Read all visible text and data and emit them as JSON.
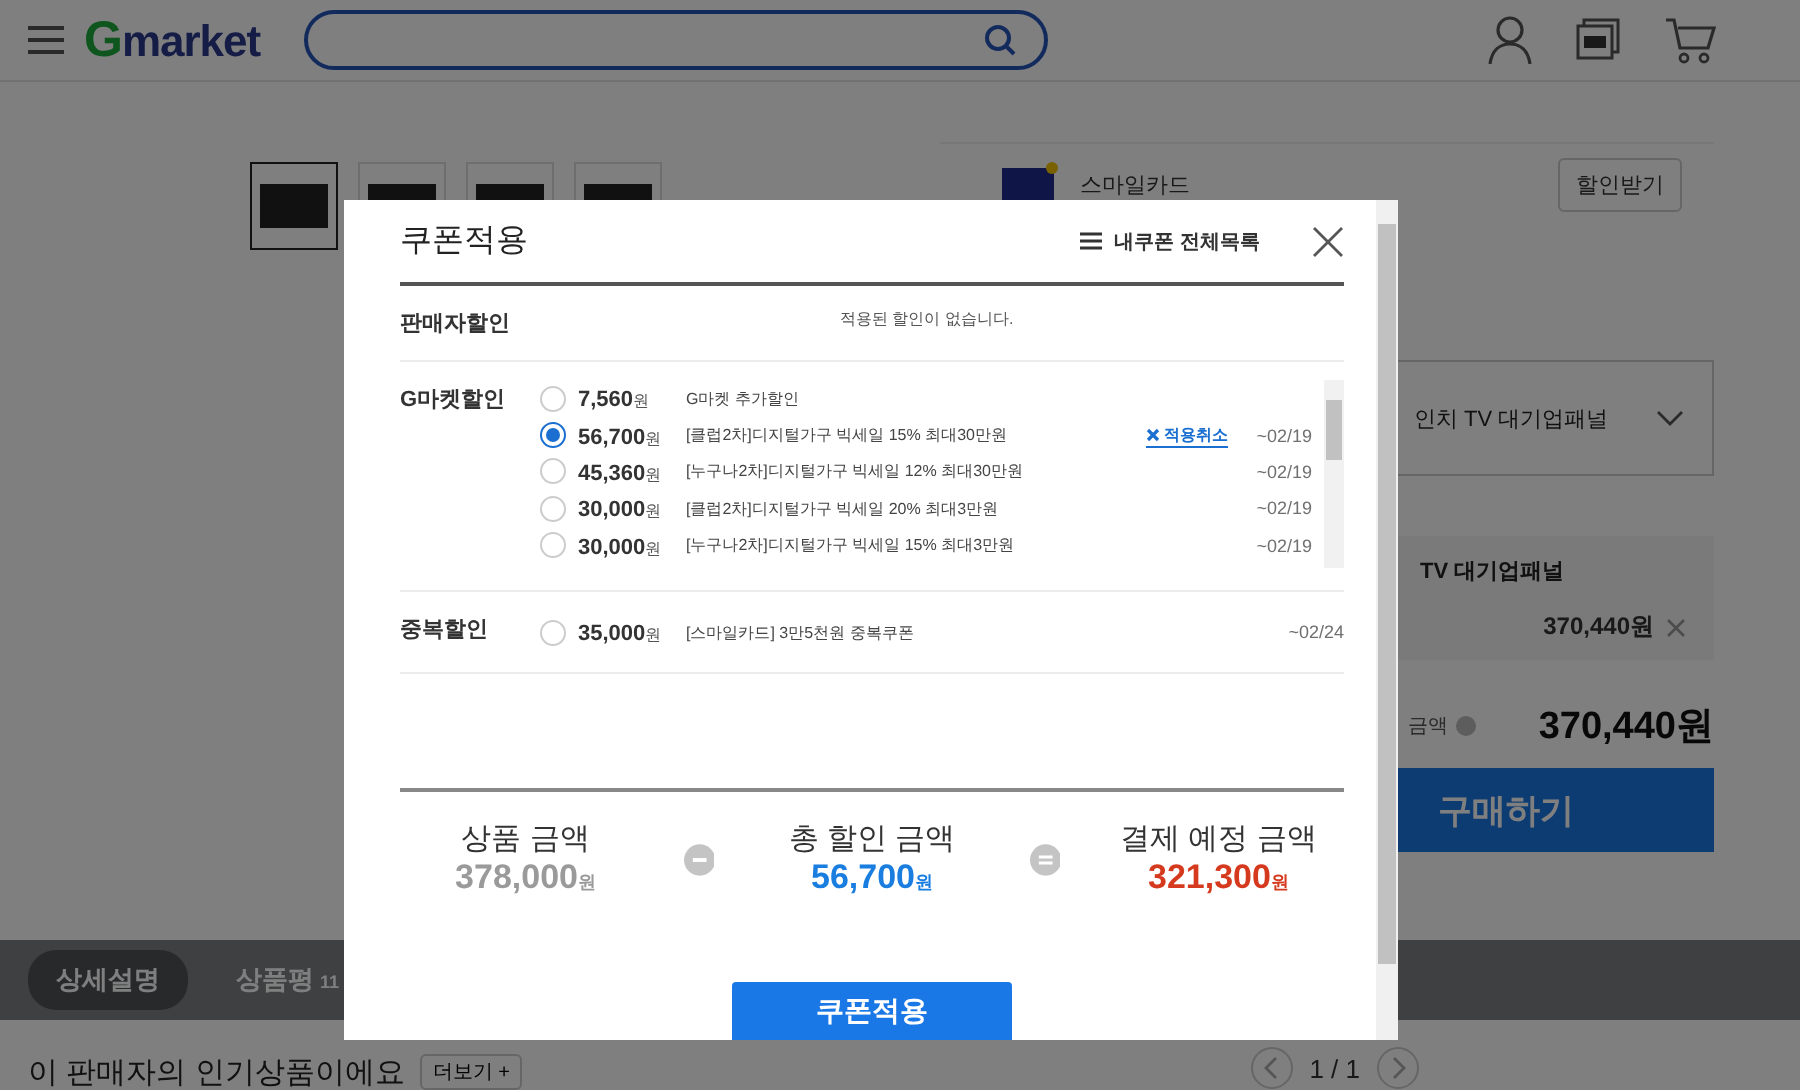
{
  "header": {
    "logo": "Gmarket"
  },
  "product": {
    "thumbnails": [
      {
        "selected": true
      },
      {
        "selected": false
      },
      {
        "selected": false
      },
      {
        "selected": false
      }
    ]
  },
  "card_promo": {
    "label": "스마일카드",
    "button": "할인받기"
  },
  "option_select": {
    "value": "인치 TV 대기업패널"
  },
  "selected_item": {
    "name": "TV 대기업패널",
    "price": "370,440원"
  },
  "total": {
    "label": "금액",
    "amount": "370,440원"
  },
  "buy_button": "구매하기",
  "tabs": [
    {
      "label": "상세설명",
      "selected": true
    },
    {
      "label": "상품평",
      "count": "11",
      "selected": false
    }
  ],
  "seller_section": {
    "title": "이 판매자의 인기상품이에요",
    "more": "더보기 +",
    "pager": "1 / 1"
  },
  "modal": {
    "title": "쿠폰적용",
    "my_coupons": "내쿠폰 전체목록",
    "sections": [
      {
        "label": "판매자할인",
        "empty_text": "적용된 할인이 없습니다."
      },
      {
        "label": "G마켓할인",
        "scroll": true,
        "coupons": [
          {
            "amount": "7,560",
            "unit": "원",
            "name": "G마켓 추가할인",
            "selected": false
          },
          {
            "amount": "56,700",
            "unit": "원",
            "name": "[클럽2차]디지털가구 빅세일 15% 최대30만원",
            "selected": true,
            "cancel": "적용취소",
            "expiry": "~02/19"
          },
          {
            "amount": "45,360",
            "unit": "원",
            "name": "[누구나2차]디지털가구 빅세일 12% 최대30만원",
            "selected": false,
            "expiry": "~02/19"
          },
          {
            "amount": "30,000",
            "unit": "원",
            "name": "[클럽2차]디지털가구 빅세일 20% 최대3만원",
            "selected": false,
            "expiry": "~02/19"
          },
          {
            "amount": "30,000",
            "unit": "원",
            "name": "[누구나2차]디지털가구 빅세일 15% 최대3만원",
            "selected": false,
            "expiry": "~02/19"
          }
        ]
      },
      {
        "label": "중복할인",
        "scroll": false,
        "coupons": [
          {
            "amount": "35,000",
            "unit": "원",
            "name": "[스마일카드] 3만5천원 중복쿠폰",
            "selected": false,
            "expiry": "~02/24"
          }
        ]
      }
    ],
    "summary": [
      {
        "label": "상품 금액",
        "amount": "378,000",
        "unit": "원",
        "color": "#9a9a9a"
      },
      {
        "label": "총 할인 금액",
        "amount": "56,700",
        "unit": "원",
        "color": "#1a7ee0"
      },
      {
        "label": "결제 예정 금액",
        "amount": "321,300",
        "unit": "원",
        "color": "#d63a1e"
      }
    ],
    "apply_button": "쿠폰적용"
  }
}
